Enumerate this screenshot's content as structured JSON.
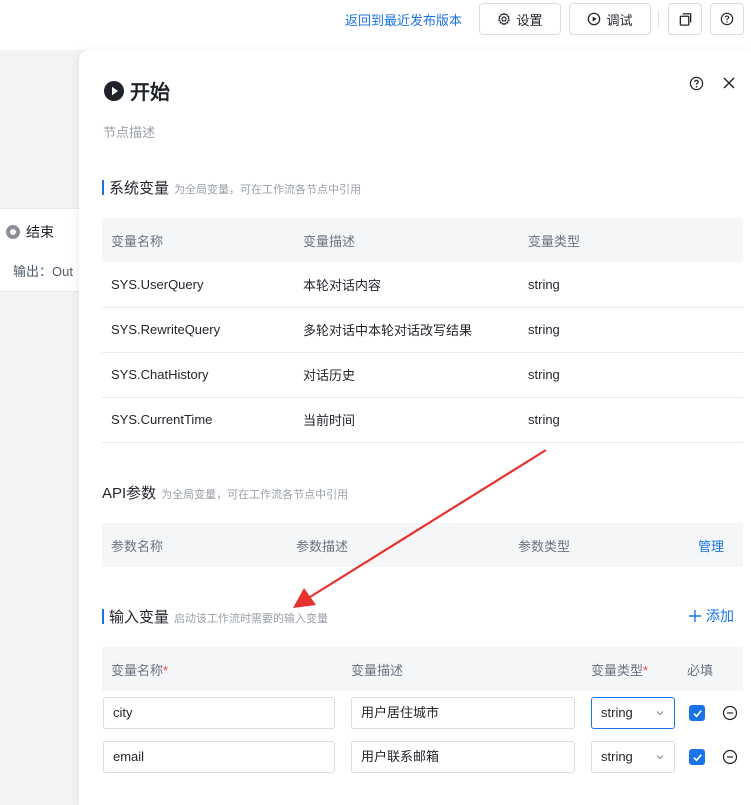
{
  "toolbar": {
    "back_link": "返回到最近发布版本",
    "settings_label": "设置",
    "debug_label": "调试"
  },
  "canvas": {
    "end_node": {
      "title": "结束",
      "output_label": "输出：Out"
    }
  },
  "panel": {
    "title": "开始",
    "node_description_placeholder": "节点描述",
    "system_vars": {
      "title": "系统变量",
      "hint": "为全局变量，可在工作流各节点中引用",
      "columns": [
        "变量名称",
        "变量描述",
        "变量类型"
      ],
      "rows": [
        [
          "SYS.UserQuery",
          "本轮对话内容",
          "string"
        ],
        [
          "SYS.RewriteQuery",
          "多轮对话中本轮对话改写结果",
          "string"
        ],
        [
          "SYS.ChatHistory",
          "对话历史",
          "string"
        ],
        [
          "SYS.CurrentTime",
          "当前时间",
          "string"
        ]
      ]
    },
    "api_params": {
      "title": "API参数",
      "hint": "为全局变量，可在工作流各节点中引用",
      "columns": [
        "参数名称",
        "参数描述",
        "参数类型"
      ],
      "manage_label": "管理"
    },
    "input_vars": {
      "title": "输入变量",
      "hint": "启动该工作流时需要的输入变量",
      "add_label": "添加",
      "columns": {
        "name": "变量名称",
        "desc": "变量描述",
        "type": "变量类型",
        "required": "必填",
        "required_mark": "*"
      },
      "rows": [
        {
          "name": "city",
          "desc": "用户居住城市",
          "type": "string",
          "required": true
        },
        {
          "name": "email",
          "desc": "用户联系邮箱",
          "type": "string",
          "required": true
        }
      ]
    }
  },
  "colors": {
    "accent": "#1a73e8",
    "annotation_arrow": "#e8312f",
    "required_star": "#f53f3f"
  },
  "icons": [
    "gear-icon",
    "play-circle-icon",
    "copy-icon",
    "help-icon",
    "close-icon",
    "plus-icon",
    "chevron-down-icon",
    "check-icon",
    "minus-circle-icon"
  ]
}
